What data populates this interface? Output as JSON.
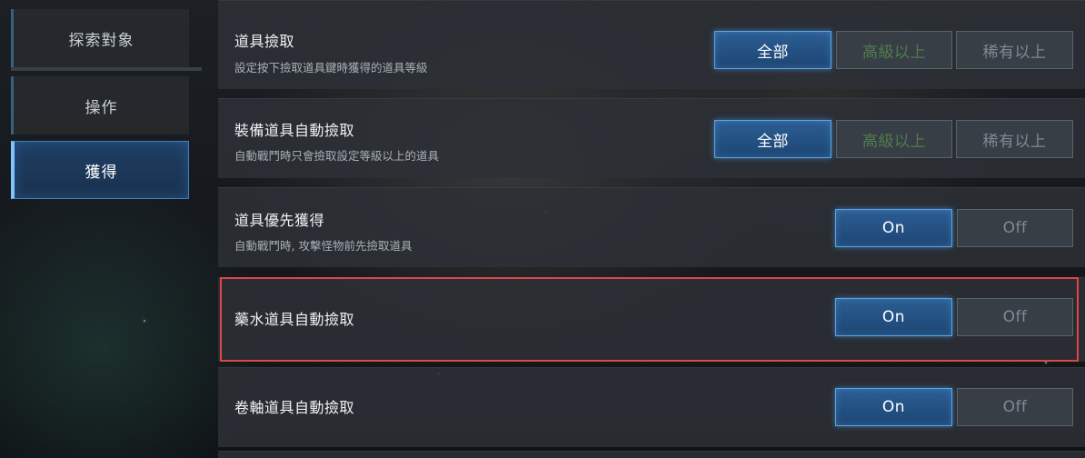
{
  "sidebar": {
    "tabs": [
      {
        "label": "探索對象"
      },
      {
        "label": "操作"
      },
      {
        "label": "獲得"
      }
    ]
  },
  "settings": {
    "item_pickup": {
      "title": "道具撿取",
      "desc": "設定按下撿取道具鍵時獲得的道具等級",
      "options": [
        "全部",
        "高級以上",
        "稀有以上"
      ],
      "selected": "全部"
    },
    "equip_auto_pickup": {
      "title": "裝備道具自動撿取",
      "desc": "自動戰鬥時只會撿取設定等級以上的道具",
      "options": [
        "全部",
        "高級以上",
        "稀有以上"
      ],
      "selected": "全部"
    },
    "item_priority": {
      "title": "道具優先獲得",
      "desc": "自動戰鬥時, 攻擊怪物前先撿取道具",
      "on_label": "On",
      "off_label": "Off",
      "value": "On"
    },
    "potion_auto_pickup": {
      "title": "藥水道具自動撿取",
      "on_label": "On",
      "off_label": "Off",
      "value": "On"
    },
    "scroll_auto_pickup": {
      "title": "卷軸道具自動撿取",
      "on_label": "On",
      "off_label": "Off",
      "value": "On"
    }
  },
  "colors": {
    "active_button": "#2b5d93",
    "active_border": "#58a6e8",
    "highlight": "#e0454a"
  }
}
